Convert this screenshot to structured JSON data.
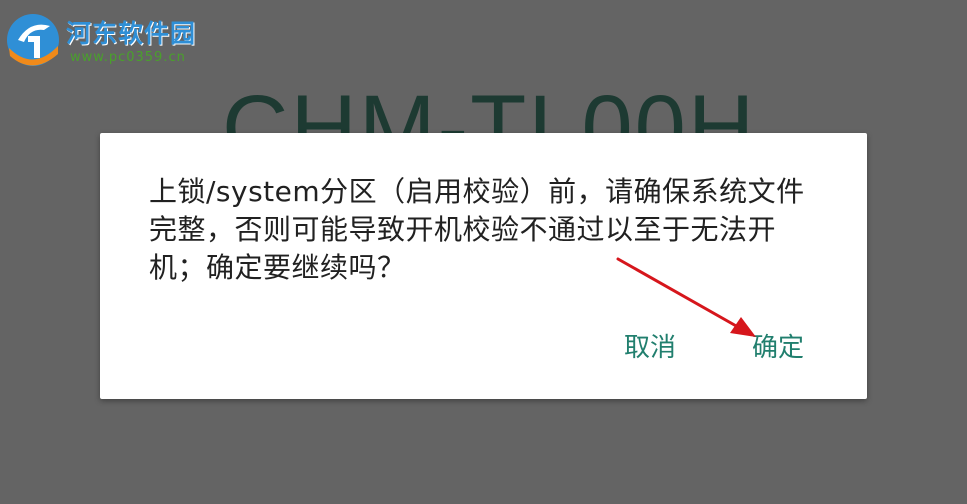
{
  "watermark": {
    "name": "河东软件园",
    "url": "www.pc0359.cn"
  },
  "background": {
    "device_title": "CHM-TL00H"
  },
  "dialog": {
    "message": "上锁/system分区（启用校验）前，请确保系统文件完整，否则可能导致开机校验不通过以至于无法开机；确定要继续吗？",
    "cancel_label": "取消",
    "ok_label": "确定"
  },
  "colors": {
    "background": "#646464",
    "button_text": "#217f6e",
    "arrow": "#d6161c"
  }
}
